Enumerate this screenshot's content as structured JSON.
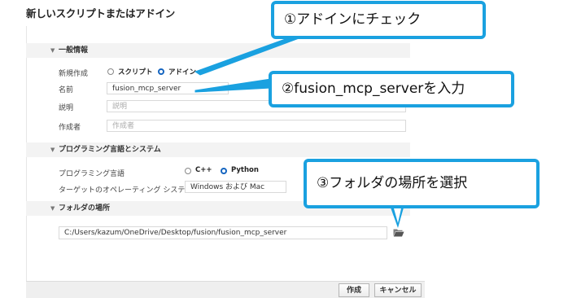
{
  "dialog": {
    "title": "新しいスクリプトまたはアドイン"
  },
  "general": {
    "header": "一般情報",
    "type_label": "新規作成",
    "type_options": [
      {
        "label": "スクリプト",
        "selected": false
      },
      {
        "label": "アドイン",
        "selected": true
      }
    ],
    "name_label": "名前",
    "name_value": "fusion_mcp_server",
    "description_label": "説明",
    "description_placeholder": "説明",
    "author_label": "作成者",
    "author_placeholder": "作成者"
  },
  "language": {
    "header": "プログラミング言語とシステム",
    "language_label": "プログラミング言語",
    "language_options": [
      {
        "label": "C++",
        "selected": false
      },
      {
        "label": "Python",
        "selected": true
      }
    ],
    "os_label": "ターゲットのオペレーティング システム",
    "os_value": "Windows および Mac"
  },
  "folder": {
    "header": "フォルダの場所",
    "path": "C:/Users/kazum/OneDrive/Desktop/fusion/fusion_mcp_server",
    "icon": "folder-open-icon"
  },
  "buttons": {
    "create": "作成",
    "cancel": "キャンセル"
  },
  "annotations": {
    "callout1": "①アドインにチェック",
    "callout2": "②fusion_mcp_serverを入力",
    "callout3": "③フォルダの場所を選択",
    "color": "#1aa1e0"
  }
}
